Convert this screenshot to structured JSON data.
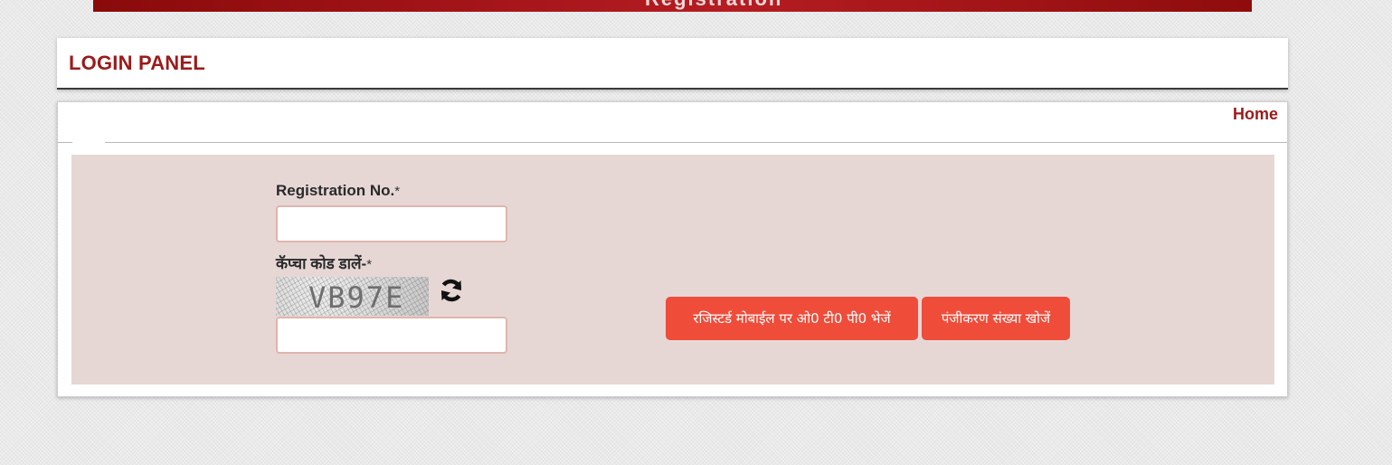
{
  "banner": {
    "text": "Registration"
  },
  "header": {
    "title": "LOGIN PANEL"
  },
  "nav": {
    "home_label": "Home"
  },
  "form": {
    "registration_label": "Registration No.",
    "registration_required": "*",
    "registration_value": "",
    "captcha_label": "कॅप्चा कोड डालें-",
    "captcha_required": "*",
    "captcha_code": "VB97E",
    "captcha_value": "",
    "refresh_icon": "refresh-icon"
  },
  "buttons": {
    "send_otp_label": "रजिस्टर्ड  मोबाईल पर ओ0 टी0 पी0 भेजें",
    "find_registration_label": "पंजीकरण संख्या खोजें"
  },
  "colors": {
    "brand": "#9b1b1b",
    "button": "#ef4c3a",
    "form_background": "#e6d7d5",
    "input_border": "#e0b4ae"
  }
}
